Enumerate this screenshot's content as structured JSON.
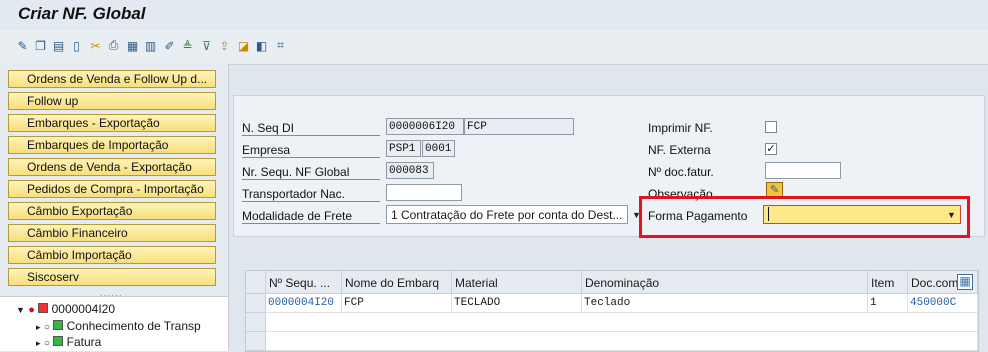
{
  "window": {
    "title": "Criar NF. Global"
  },
  "toolbar": {
    "icons": [
      "edit-icon",
      "copy-doc-icon",
      "paste-icon",
      "new-doc-icon",
      "cut-icon",
      "print-icon",
      "layout-icon",
      "grid-icon",
      "modify-icon",
      "sort-ascending-icon",
      "filter-icon",
      "export-icon",
      "chart-icon",
      "info-icon",
      "network-icon"
    ]
  },
  "sidebar": {
    "buttons": [
      "Ordens de Venda e Follow Up d...",
      "Follow up",
      "Embarques - Exportação",
      "Embarques de Importação",
      "Ordens de Venda - Exportação",
      "Pedidos de Compra - Importação",
      "Câmbio Exportação",
      "Câmbio Financeiro",
      "Câmbio Importação",
      "Siscoserv"
    ],
    "dots": "......",
    "tree": {
      "root": "0000004I20",
      "children": [
        "Conhecimento de Transp",
        "Fatura"
      ]
    }
  },
  "form": {
    "n_seq_di": {
      "label": "N. Seq DI",
      "value1": "0000006I20",
      "value2": "FCP"
    },
    "empresa": {
      "label": "Empresa",
      "value1": "PSP1",
      "value2": "0001"
    },
    "nr_sequ_nf_global": {
      "label": "Nr. Sequ. NF Global",
      "value": "000083"
    },
    "transportador": {
      "label": "Transportador Nac.",
      "value": ""
    },
    "modalidade_frete": {
      "label": "Modalidade de Frete",
      "value": "1 Contratação do Frete por conta do Dest..."
    },
    "imprimir_nf": {
      "label": "Imprimir NF.",
      "checked": ""
    },
    "nf_externa": {
      "label": "NF. Externa",
      "checked": "✓"
    },
    "no_doc_fatur": {
      "label": "Nº doc.fatur.",
      "value": ""
    },
    "observacao": {
      "label": "Observação"
    },
    "forma_pagamento": {
      "label": "Forma Pagamento",
      "value": ""
    }
  },
  "table": {
    "headers": [
      "Nº Sequ. ...",
      "Nome do Embarq",
      "Material",
      "Denominação",
      "Item",
      "Doc.com"
    ],
    "rows": [
      [
        "0000004I20",
        "FCP",
        "TECLADO",
        "Teclado",
        "1",
        "450000C"
      ]
    ]
  },
  "colors": {
    "nav_button": "#f7df7a",
    "highlight": "#e0141e",
    "link": "#1f5fa5"
  }
}
